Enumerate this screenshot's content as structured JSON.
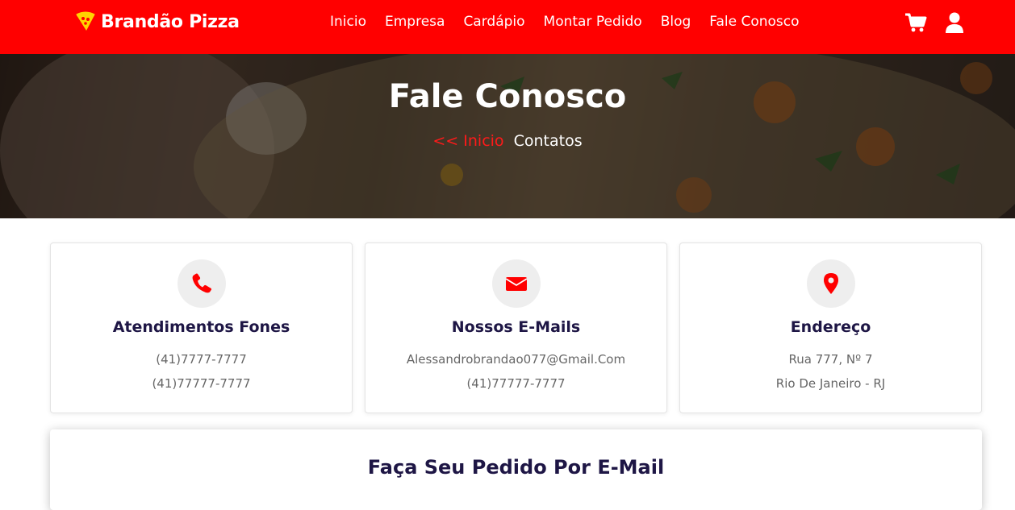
{
  "nav": {
    "brand": "Brandão Pizza",
    "links": [
      "Inicio",
      "Empresa",
      "Cardápio",
      "Montar Pedido",
      "Blog",
      "Fale Conosco"
    ],
    "icons": [
      "cart-icon",
      "user-icon"
    ]
  },
  "hero": {
    "title": "Fale Conosco",
    "breadcrumb_home": "<< Inicio",
    "breadcrumb_current": "Contatos"
  },
  "cards": [
    {
      "icon": "phone-icon",
      "title": "Atendimentos Fones",
      "line1": "(41)7777-7777",
      "line2": "(41)77777-7777"
    },
    {
      "icon": "envelope-icon",
      "title": "Nossos E-Mails",
      "line1": "Alessandrobrandao077@Gmail.Com",
      "line2": "(41)77777-7777"
    },
    {
      "icon": "map-marker-icon",
      "title": "Endereço",
      "line1": "Rua 777, Nº 7",
      "line2": "Rio De Janeiro - RJ"
    }
  ],
  "order": {
    "title": "Faça Seu Pedido Por E-Mail"
  },
  "colors": {
    "brand_red": "#ff0000",
    "title_navy": "#1e1645",
    "icon_bg": "#eeeeee"
  }
}
